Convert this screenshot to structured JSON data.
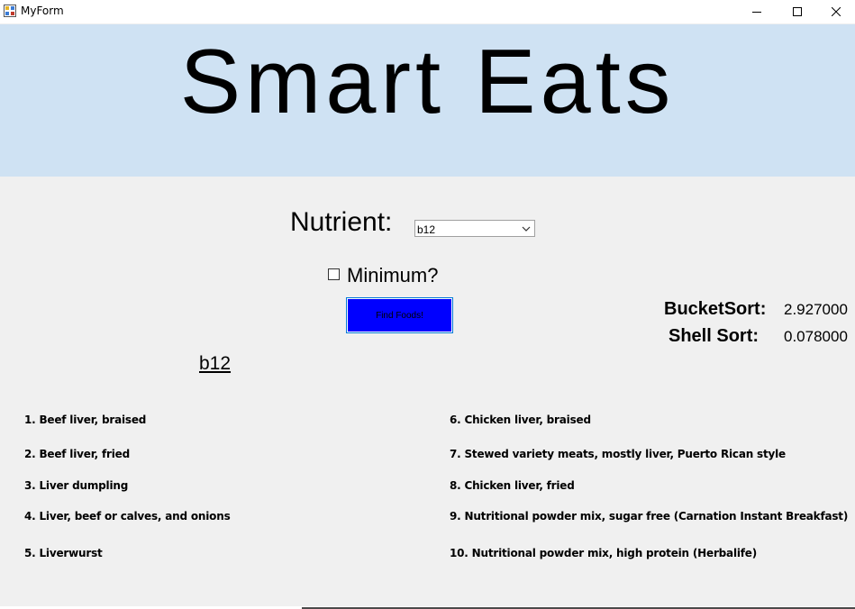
{
  "window": {
    "title": "MyForm"
  },
  "banner": {
    "title": "Smart Eats"
  },
  "form": {
    "nutrient_label": "Nutrient:",
    "nutrient_selected": "b12",
    "minimum_label": "Minimum?",
    "minimum_checked": false,
    "find_button_label": "Find Foods!"
  },
  "timing": {
    "bucket_label": "BucketSort:",
    "bucket_value": "2.927000",
    "shell_label": "Shell Sort:",
    "shell_value": "0.078000"
  },
  "results": {
    "heading": "b12",
    "foods": [
      "1. Beef liver, braised",
      "2. Beef liver, fried",
      "3. Liver dumpling",
      "4. Liver, beef or calves, and onions",
      "5. Liverwurst",
      "6. Chicken liver, braised",
      "7. Stewed variety meats, mostly liver, Puerto Rican style",
      "8. Chicken liver, fried",
      "9. Nutritional powder mix, sugar free (Carnation Instant Breakfast)",
      "10. Nutritional powder mix, high protein (Herbalife)"
    ]
  },
  "colors": {
    "banner_bg": "#cfe2f3",
    "button_bg": "#0000ff",
    "window_bg": "#f0f0f0"
  }
}
